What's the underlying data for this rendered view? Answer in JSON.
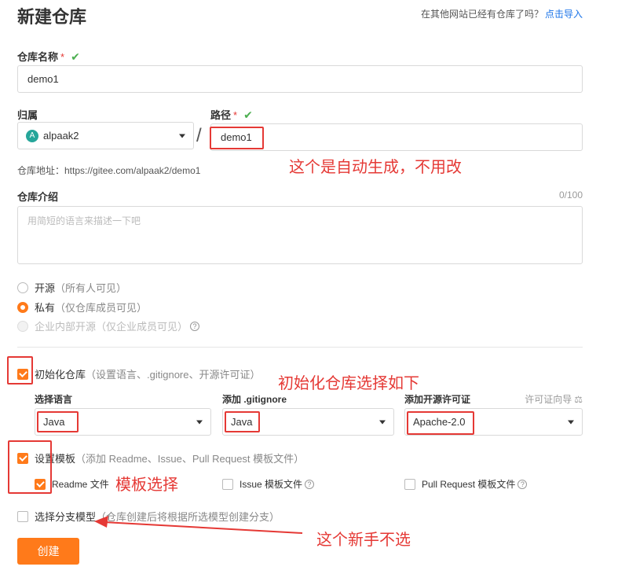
{
  "header": {
    "title": "新建仓库",
    "import_prompt": "在其他网站已经有仓库了吗？",
    "import_link": "点击导入"
  },
  "repo_name": {
    "label": "仓库名称",
    "required": "*",
    "value": "demo1"
  },
  "owner": {
    "label": "归属",
    "avatar_letter": "A",
    "value": "alpaak2"
  },
  "separator": "/",
  "path": {
    "label": "路径",
    "required": "*",
    "value": "demo1"
  },
  "repo_url": "仓库地址：https://gitee.com/alpaak2/demo1",
  "intro": {
    "label": "仓库介绍",
    "counter": "0/100",
    "placeholder": "用简短的语言来描述一下吧"
  },
  "visibility": {
    "open": {
      "label": "开源",
      "hint": "（所有人可见）"
    },
    "private": {
      "label": "私有",
      "hint": "（仅仓库成员可见）"
    },
    "internal": {
      "label": "企业内部开源",
      "hint": "（仅企业成员可见）"
    }
  },
  "init_repo": {
    "label": "初始化仓库",
    "hint": "（设置语言、.gitignore、开源许可证）"
  },
  "language": {
    "label": "选择语言",
    "value": "Java"
  },
  "gitignore": {
    "label": "添加 .gitignore",
    "value": "Java"
  },
  "license": {
    "label": "添加开源许可证",
    "guide": "许可证向导",
    "value": "Apache-2.0"
  },
  "template": {
    "label": "设置模板",
    "hint": "（添加 Readme、Issue、Pull Request 模板文件）",
    "readme": "Readme 文件",
    "issue": "Issue 模板文件",
    "pr": "Pull Request 模板文件"
  },
  "branch_model": {
    "label": "选择分支模型",
    "hint": "（仓库创建后将根据所选模型创建分支）"
  },
  "create_button": "创建",
  "annotations": {
    "auto": "这个是自动生成，不用改",
    "init": "初始化仓库选择如下",
    "tmpl": "模板选择",
    "novice": "这个新手不选"
  },
  "colors": {
    "accent": "#ff7a1a",
    "annotation": "#e53935",
    "check": "#4caf50",
    "link": "#1a73e8"
  }
}
